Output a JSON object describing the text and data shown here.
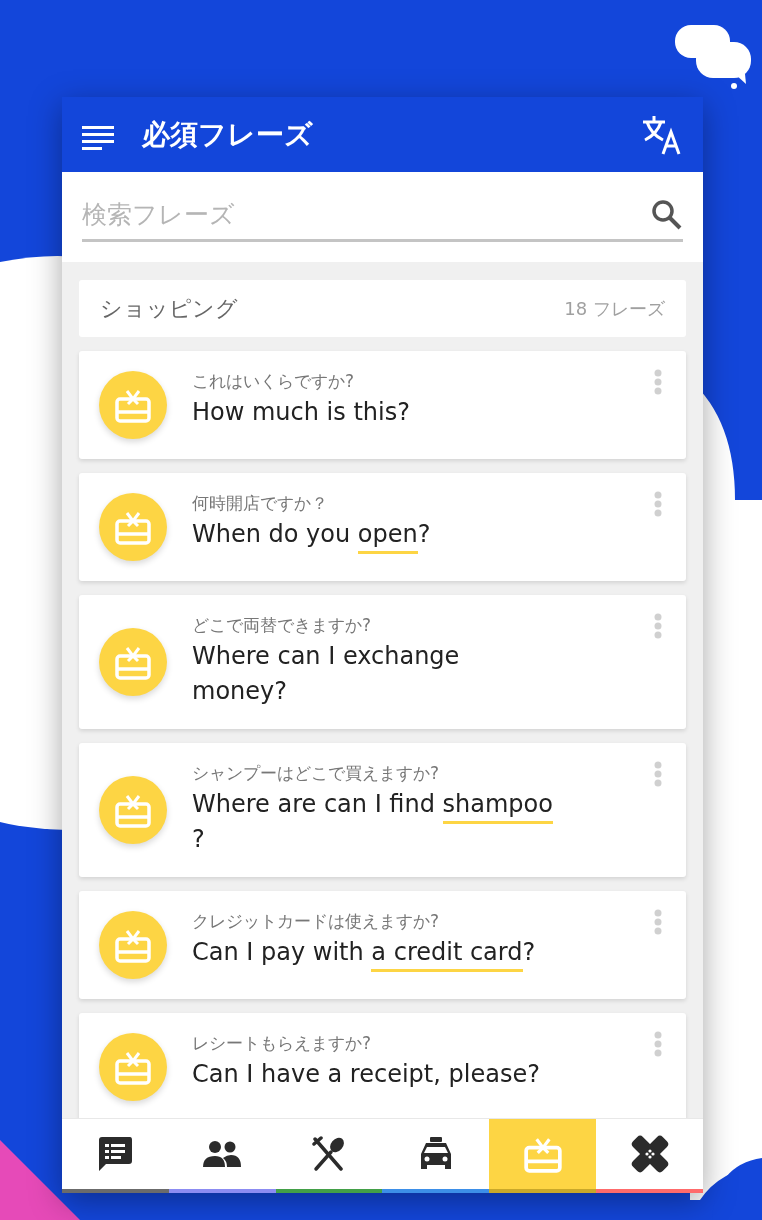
{
  "app_bar": {
    "title": "必須フレーズ"
  },
  "search": {
    "placeholder": "検索フレーズ"
  },
  "category": {
    "name": "ショッピング",
    "count": "18 フレーズ"
  },
  "phrases": [
    {
      "japanese": "これはいくらですか?",
      "english": [
        {
          "text": "How much is this?",
          "highlighted": false
        }
      ]
    },
    {
      "japanese": "何時開店ですか？",
      "english": [
        {
          "text": "When do you ",
          "highlighted": false
        },
        {
          "text": "open",
          "highlighted": true
        },
        {
          "text": "?",
          "highlighted": false
        }
      ]
    },
    {
      "japanese": "どこで両替できますか?",
      "english": [
        {
          "text": "Where can I exchange money?",
          "highlighted": false
        }
      ]
    },
    {
      "japanese": "シャンプーはどこで買えますか?",
      "english": [
        {
          "text": "Where are can I find ",
          "highlighted": false
        },
        {
          "text": "shampoo",
          "highlighted": true
        },
        {
          "text": " ?",
          "highlighted": false
        }
      ]
    },
    {
      "japanese": "クレジットカードは使えますか?",
      "english": [
        {
          "text": "Can I pay with ",
          "highlighted": false
        },
        {
          "text": "a credit card",
          "highlighted": true
        },
        {
          "text": "?",
          "highlighted": false
        }
      ]
    },
    {
      "japanese": "レシートもらえますか?",
      "english": [
        {
          "text": "Can I have a receipt, please?",
          "highlighted": false
        }
      ]
    }
  ],
  "nav_tabs": [
    {
      "kind": "messages",
      "selected": false,
      "color": "#6b6b6b"
    },
    {
      "kind": "people",
      "selected": false,
      "color": "#8c8cf2"
    },
    {
      "kind": "dining",
      "selected": false,
      "color": "#43a047"
    },
    {
      "kind": "taxi",
      "selected": false,
      "color": "#3d8fe8"
    },
    {
      "kind": "shopping",
      "selected": true,
      "color": "#c9a82a"
    },
    {
      "kind": "first-aid",
      "selected": false,
      "color": "#ff6b6b"
    }
  ]
}
